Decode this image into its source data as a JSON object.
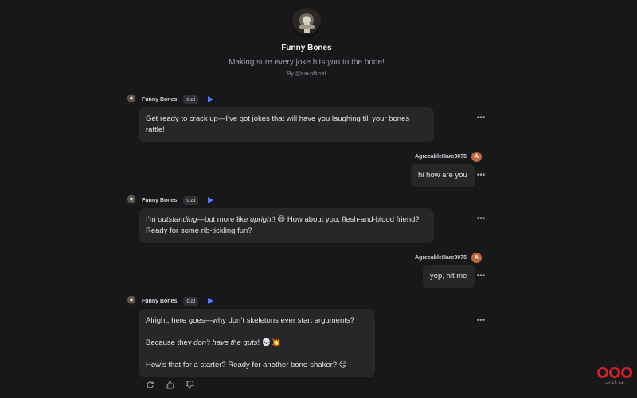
{
  "character": {
    "name": "Funny Bones",
    "tagline": "Making sure every joke hits you to the bone!",
    "author": "By @cai-official",
    "badge": "c.ai"
  },
  "user": {
    "name": "AgreeableHare3075",
    "initial": "A"
  },
  "messages": [
    {
      "text": "Get ready to crack up—I’ve got jokes that will have you laughing till your bones rattle!"
    },
    {
      "text": "hi how are you"
    },
    {
      "p1": "I’m ",
      "p1_em": "outstanding",
      "p1_b": "—but more like ",
      "p1_em2": "upright",
      "p1_c": "! 😄 How about you, flesh-and-blood friend? Ready for some rib-tickling fun?"
    },
    {
      "text": "yep, hit me"
    },
    {
      "l1": "Alright, here goes—why don’t skeletons ever start arguments?",
      "l2a": "Because they ",
      "l2_em": "don’t have the guts",
      "l2b": "! 💀💥",
      "l3": "How’s that for a starter? Ready for another bone-shaker? 😏"
    }
  ],
  "more_label": "•••",
  "icons": {
    "play": "play-icon",
    "more": "more-icon",
    "regenerate": "refresh-icon",
    "like": "thumbs-up-icon",
    "dislike": "thumbs-down-icon"
  },
  "logo": {
    "text": "پایان آپارات"
  },
  "colors": {
    "background": "#18181b",
    "bubble": "#27272a",
    "accent": "#5b7cf7",
    "user_avatar": "#c0663c",
    "logo": "#d21f2b"
  }
}
